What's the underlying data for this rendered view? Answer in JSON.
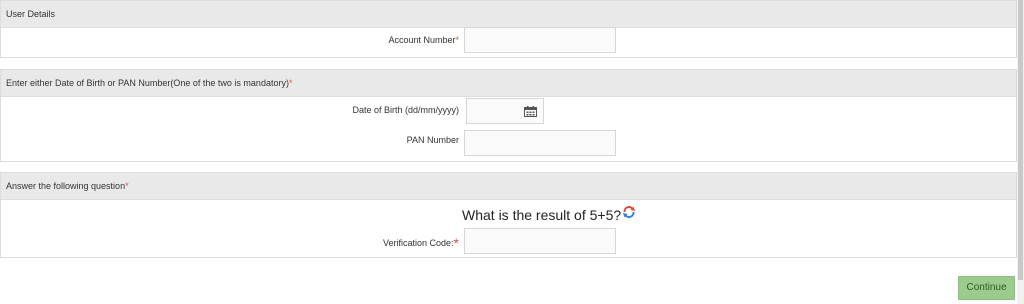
{
  "sections": {
    "user_details": {
      "title": "User Details",
      "account_number_label": "Account Number",
      "required_mark": "*"
    },
    "dob_pan": {
      "title": "Enter either Date of Birth or PAN Number(One of the two is mandatory)",
      "required_mark": "*",
      "dob_label": "Date of Birth (dd/mm/yyyy)",
      "pan_label": "PAN Number"
    },
    "question": {
      "title": "Answer the following question",
      "required_mark": "*",
      "question_text": "What is the result of 5+5?",
      "verification_label": "Verification Code:",
      "verification_required": "*"
    }
  },
  "actions": {
    "continue_label": "Continue"
  },
  "icons": {
    "calendar": "calendar-icon",
    "refresh": "refresh-icon"
  },
  "colors": {
    "required": "#d9534f",
    "continue_bg": "#9ccc8c",
    "header_bg": "#e9e9e9"
  }
}
